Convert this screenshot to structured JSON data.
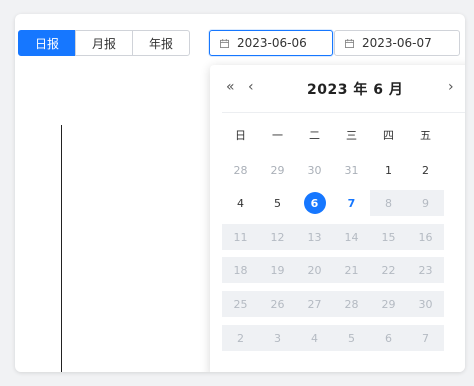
{
  "period_tabs": [
    {
      "label": "日报",
      "active": true
    },
    {
      "label": "月报",
      "active": false
    },
    {
      "label": "年报",
      "active": false
    }
  ],
  "range": {
    "start": "2023-06-06",
    "end": "2023-06-07"
  },
  "calendar": {
    "nav_prev_year": "«",
    "nav_prev_month": "‹",
    "nav_next_month": "›",
    "title": "2023 年  6 月",
    "weekdays": [
      "日",
      "一",
      "二",
      "三",
      "四",
      "五"
    ],
    "rows": [
      [
        {
          "d": "28",
          "s": "dim"
        },
        {
          "d": "29",
          "s": "dim"
        },
        {
          "d": "30",
          "s": "dim"
        },
        {
          "d": "31",
          "s": "dim"
        },
        {
          "d": "1",
          "s": "cur"
        },
        {
          "d": "2",
          "s": "cur"
        }
      ],
      [
        {
          "d": "4",
          "s": "cur"
        },
        {
          "d": "5",
          "s": "cur"
        },
        {
          "d": "6",
          "s": "selected"
        },
        {
          "d": "7",
          "s": "today"
        },
        {
          "d": "8",
          "s": "disabled"
        },
        {
          "d": "9",
          "s": "disabled"
        }
      ],
      [
        {
          "d": "11",
          "s": "disabled"
        },
        {
          "d": "12",
          "s": "disabled"
        },
        {
          "d": "13",
          "s": "disabled"
        },
        {
          "d": "14",
          "s": "disabled"
        },
        {
          "d": "15",
          "s": "disabled"
        },
        {
          "d": "16",
          "s": "disabled"
        }
      ],
      [
        {
          "d": "18",
          "s": "disabled"
        },
        {
          "d": "19",
          "s": "disabled"
        },
        {
          "d": "20",
          "s": "disabled"
        },
        {
          "d": "21",
          "s": "disabled"
        },
        {
          "d": "22",
          "s": "disabled"
        },
        {
          "d": "23",
          "s": "disabled"
        }
      ],
      [
        {
          "d": "25",
          "s": "disabled"
        },
        {
          "d": "26",
          "s": "disabled"
        },
        {
          "d": "27",
          "s": "disabled"
        },
        {
          "d": "28",
          "s": "disabled"
        },
        {
          "d": "29",
          "s": "disabled"
        },
        {
          "d": "30",
          "s": "disabled"
        }
      ],
      [
        {
          "d": "2",
          "s": "disabled"
        },
        {
          "d": "3",
          "s": "disabled"
        },
        {
          "d": "4",
          "s": "disabled"
        },
        {
          "d": "5",
          "s": "disabled"
        },
        {
          "d": "6",
          "s": "disabled"
        },
        {
          "d": "7",
          "s": "disabled"
        }
      ]
    ]
  },
  "colors": {
    "accent": "#1677ff",
    "disabled_bg": "#eff1f4"
  }
}
